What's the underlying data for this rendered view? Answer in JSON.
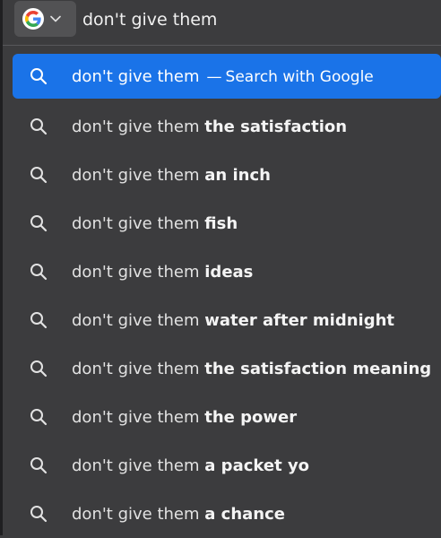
{
  "urlbar": {
    "engine_icon": "google-g-logo",
    "query": "don't give them"
  },
  "top_result": {
    "query": "don't give them",
    "separator": "—",
    "action": "Search with Google"
  },
  "suggestions": [
    {
      "prefix": "don't give them",
      "suffix": "the satisfaction"
    },
    {
      "prefix": "don't give them",
      "suffix": "an inch"
    },
    {
      "prefix": "don't give them",
      "suffix": "fish"
    },
    {
      "prefix": "don't give them",
      "suffix": "ideas"
    },
    {
      "prefix": "don't give them",
      "suffix": "water after midnight"
    },
    {
      "prefix": "don't give them",
      "suffix": "the satisfaction meaning"
    },
    {
      "prefix": "don't give them",
      "suffix": "the power"
    },
    {
      "prefix": "don't give them",
      "suffix": "a packet yo"
    },
    {
      "prefix": "don't give them",
      "suffix": "a chance"
    }
  ],
  "colors": {
    "background": "#3c3c3e",
    "selected": "#1a73e8",
    "text": "#e2e2e2"
  }
}
